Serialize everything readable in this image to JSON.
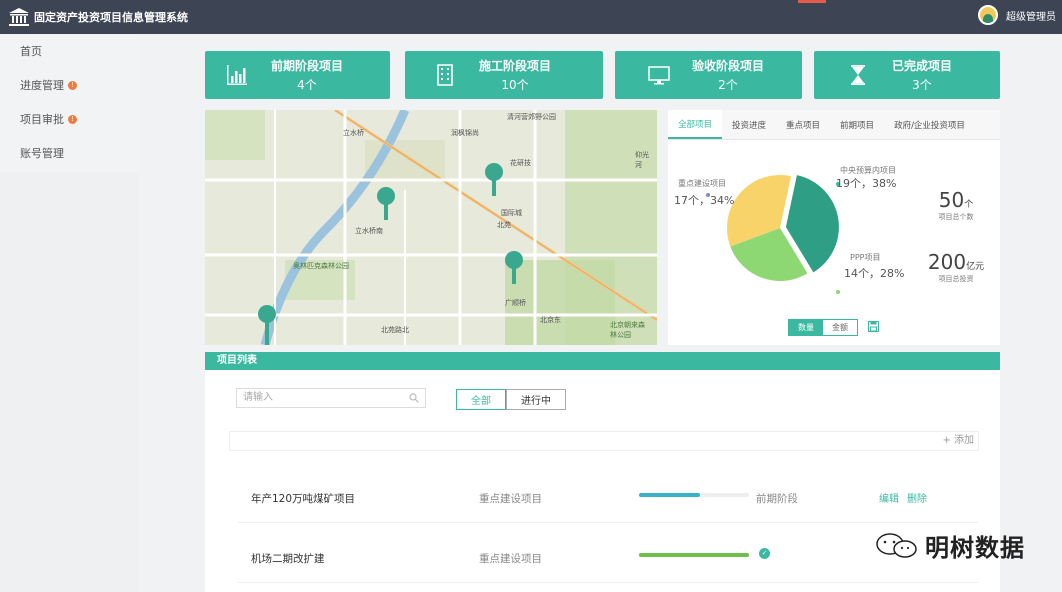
{
  "app": {
    "title": "固定资产投资项目信息管理系统"
  },
  "user": {
    "name": "超级管理员"
  },
  "sidebar": {
    "items": [
      {
        "label": "首页",
        "badge": ""
      },
      {
        "label": "进度管理",
        "badge": "!"
      },
      {
        "label": "项目审批",
        "badge": "!"
      },
      {
        "label": "账号管理",
        "badge": ""
      }
    ]
  },
  "cards": [
    {
      "title": "前期阶段项目",
      "count": "4个",
      "icon": "bar-chart-icon"
    },
    {
      "title": "施工阶段项目",
      "count": "10个",
      "icon": "building-icon"
    },
    {
      "title": "验收阶段项目",
      "count": "2个",
      "icon": "monitor-icon"
    },
    {
      "title": "已完成项目",
      "count": "3个",
      "icon": "hourglass-icon"
    }
  ],
  "map": {
    "labels": [
      "清河营郊野公园",
      "立水桥",
      "润枫锦尚",
      "立水桥南",
      "北苑",
      "奥林匹克森林公园",
      "北京朝来森林公园",
      "北苑路北",
      "广顺桥",
      "北京东",
      "花研技",
      "仰光河",
      "国际城"
    ]
  },
  "panel": {
    "tabs": [
      "全部项目",
      "投资进度",
      "重点项目",
      "前期项目",
      "政府/企业投资项目"
    ],
    "active_tab": 0,
    "stats": {
      "total": {
        "value": "50",
        "unit": "个",
        "label": "项目总个数"
      },
      "investment": {
        "value": "200",
        "unit": "亿元",
        "label": "项目总投资"
      }
    },
    "toggle": [
      "数量",
      "金额"
    ]
  },
  "chart_data": {
    "type": "pie",
    "slices": [
      {
        "name": "中央预算内项目",
        "count": 19,
        "percent": 38,
        "color": "#2e9e84"
      },
      {
        "name": "PPP项目",
        "count": 14,
        "percent": 28,
        "color": "#8ed873"
      },
      {
        "name": "重点建设项目",
        "count": 17,
        "percent": 34,
        "color": "#f8d36a"
      }
    ],
    "labels": {
      "central": {
        "name": "中央预算内项目",
        "value": "19个，38%"
      },
      "ppp": {
        "name": "PPP项目",
        "value": "14个，28%"
      },
      "key": {
        "name": "重点建设项目",
        "value": "17个，34%"
      }
    }
  },
  "list": {
    "title": "项目列表",
    "search_placeholder": "请输入",
    "filters": [
      "全部",
      "进行中"
    ],
    "add_label": "+ 添加",
    "rows": [
      {
        "name": "年产120万吨煤矿项目",
        "type": "重点建设项目",
        "progress": 0.55,
        "progress_color": "#39b3c6",
        "stage": "前期阶段",
        "edit": "编辑",
        "delete": "删除"
      },
      {
        "name": "机场二期改扩建",
        "type": "重点建设项目",
        "progress": 1.0,
        "progress_color": "#6cc04a",
        "stage": "",
        "edit": "",
        "delete": ""
      }
    ]
  },
  "watermark": {
    "text": "明树数据"
  }
}
